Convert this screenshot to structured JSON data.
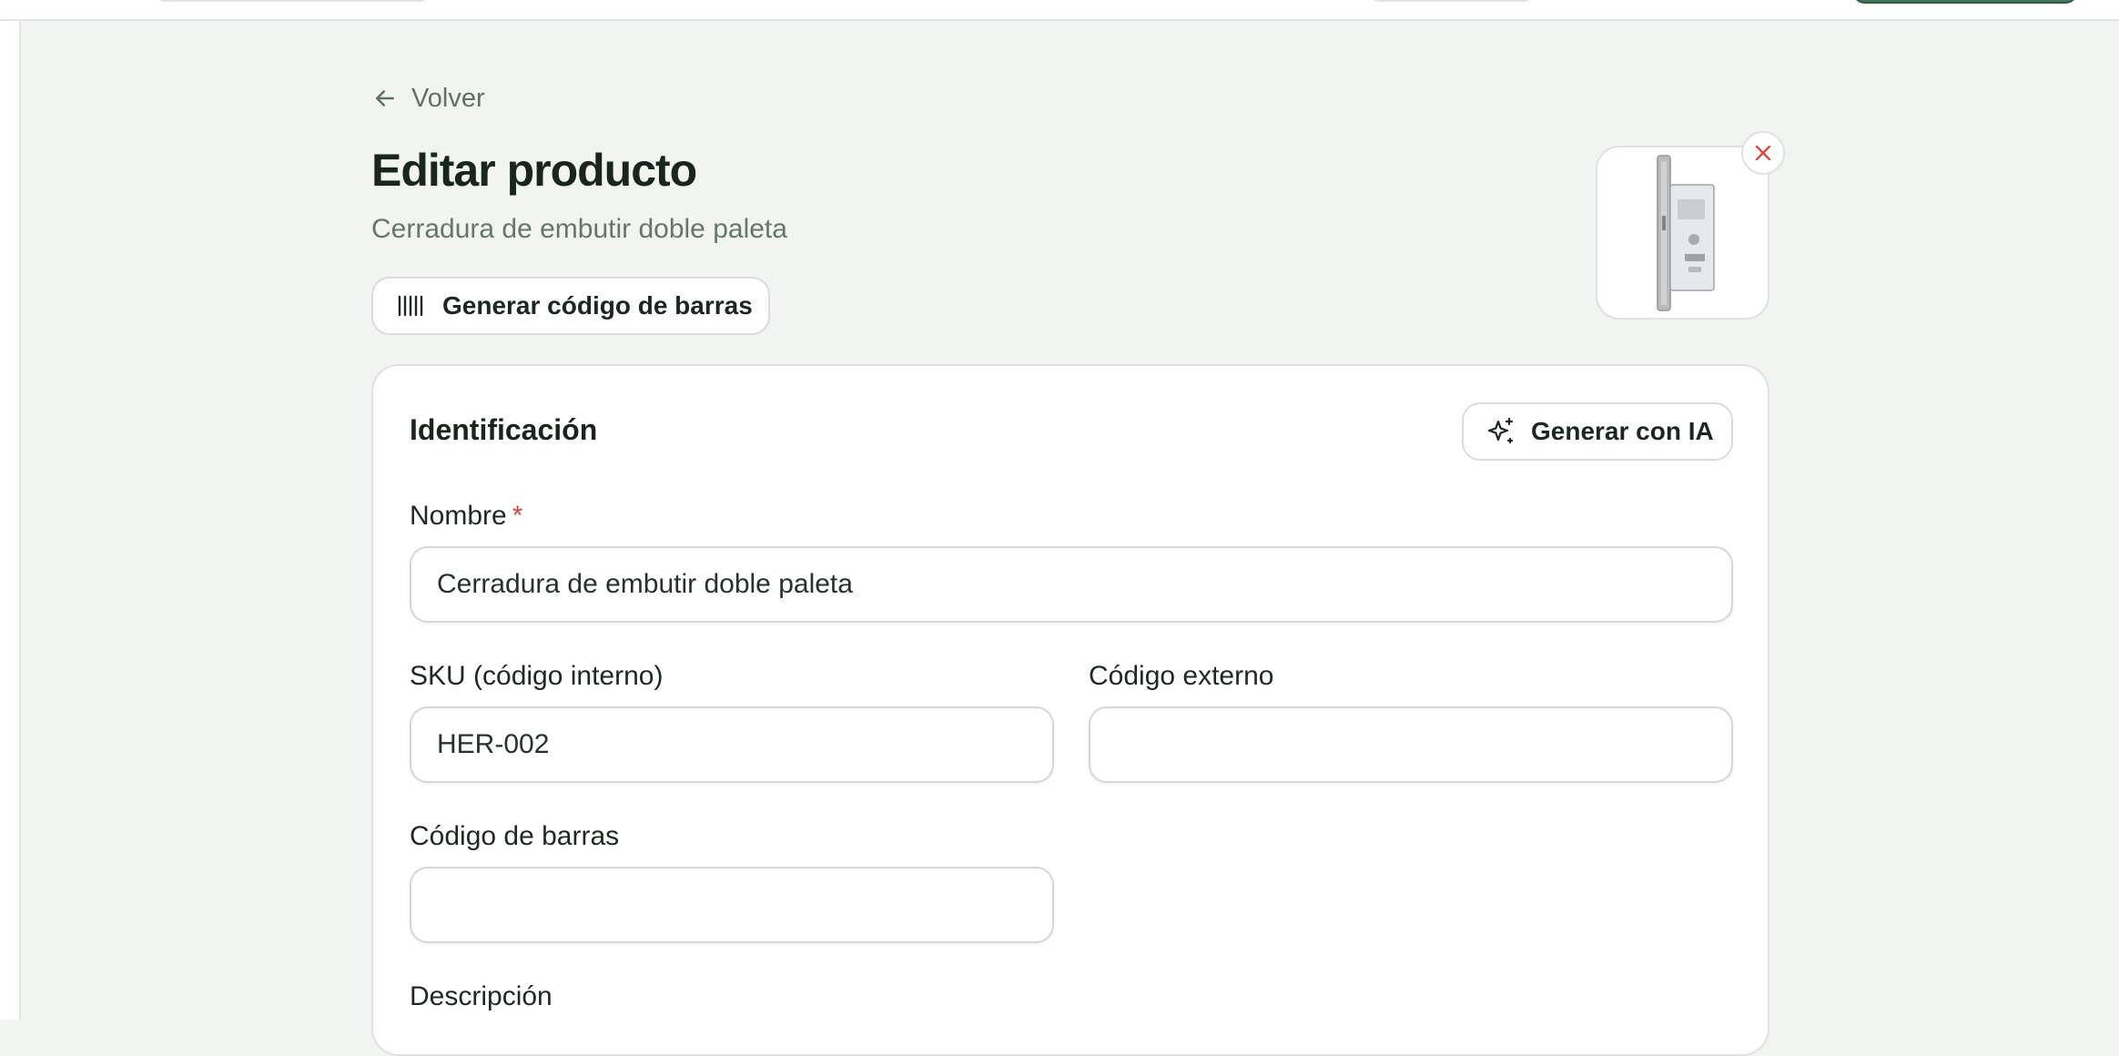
{
  "back": {
    "label": "Volver"
  },
  "header": {
    "title": "Editar producto",
    "subtitle": "Cerradura de embutir doble paleta",
    "barcode_button": "Generar código de barras"
  },
  "identification": {
    "section_title": "Identificación",
    "ai_button": "Generar con IA",
    "fields": {
      "name": {
        "label": "Nombre",
        "required_mark": "*",
        "value": "Cerradura de embutir doble paleta"
      },
      "sku": {
        "label": "SKU (código interno)",
        "value": "HER-002"
      },
      "external_code": {
        "label": "Código externo",
        "value": ""
      },
      "barcode": {
        "label": "Código de barras",
        "value": ""
      },
      "description": {
        "label": "Descripción"
      }
    }
  },
  "colors": {
    "background": "#f1f4f1",
    "accent": "#47775e",
    "required": "#d24a43",
    "remove_icon": "#d24a43"
  },
  "icons": {
    "back": "arrow-left-icon",
    "barcode": "barcode-icon",
    "ai": "sparkles-icon",
    "remove": "close-icon"
  }
}
